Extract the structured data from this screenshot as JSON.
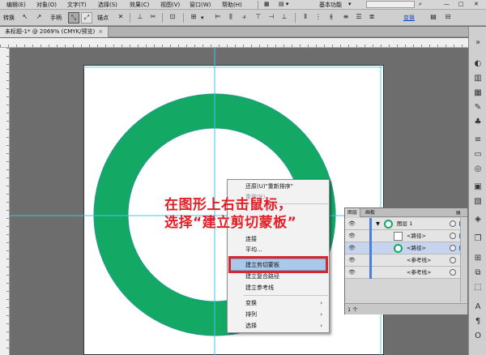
{
  "menubar": {
    "items": [
      "编辑(E)",
      "对象(O)",
      "文字(T)",
      "选择(S)",
      "效果(C)",
      "视图(V)",
      "窗口(W)",
      "帮助(H)"
    ],
    "workspace": "基本功能"
  },
  "control_bar": {
    "convert_label": "转换",
    "handle_label": "手柄",
    "anchor_label": "锚点",
    "transform_label": "变换"
  },
  "tab": {
    "title": "未标题-1* @ 2069% (CMYK/预览)",
    "close": "×"
  },
  "context_menu": {
    "items": [
      {
        "label": "还原(U)\"重新排序\"",
        "disabled": false,
        "arrow": false
      },
      {
        "label": "重做(R)",
        "disabled": true,
        "arrow": false
      },
      {
        "label": "连接",
        "disabled": false,
        "arrow": false
      },
      {
        "label": "平均...",
        "disabled": false,
        "arrow": false
      },
      {
        "label": "建立剪切蒙板",
        "disabled": false,
        "arrow": false,
        "highlighted": true
      },
      {
        "label": "建立复合路径",
        "disabled": false,
        "arrow": false
      },
      {
        "label": "建立参考线",
        "disabled": false,
        "arrow": false
      },
      {
        "label": "变换",
        "disabled": false,
        "arrow": true
      },
      {
        "label": "排列",
        "disabled": false,
        "arrow": true
      },
      {
        "label": "选择",
        "disabled": false,
        "arrow": true
      }
    ],
    "arrow_glyph": "›"
  },
  "annotation": {
    "line1": "在图形上右击鼠标，",
    "line2": "选择“建立剪切蒙板”"
  },
  "layers_panel": {
    "tabs": [
      "图层",
      "画板"
    ],
    "rows": [
      {
        "name": "图层 1",
        "thumb": "circle"
      },
      {
        "name": "<路径>",
        "thumb": "square"
      },
      {
        "name": "<路径>",
        "thumb": "circle"
      },
      {
        "name": "<参考线>",
        "thumb": "none"
      },
      {
        "name": "<参考线>",
        "thumb": "none"
      }
    ],
    "footer": "1 个"
  },
  "colors": {
    "ring": "#14a865",
    "guide": "#3ec6e8",
    "highlight_border": "#d9262c",
    "annotation_text": "#e21f26",
    "menu_highlight": "#a9c9ea"
  }
}
